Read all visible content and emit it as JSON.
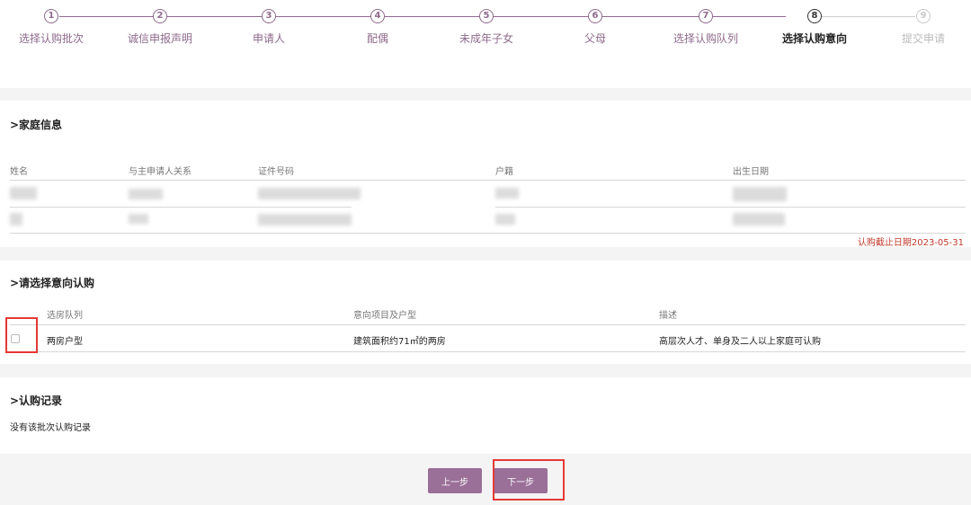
{
  "steps": [
    {
      "num": "1",
      "label": "选择认购批次"
    },
    {
      "num": "2",
      "label": "诚信申报声明"
    },
    {
      "num": "3",
      "label": "申请人"
    },
    {
      "num": "4",
      "label": "配偶"
    },
    {
      "num": "5",
      "label": "未成年子女"
    },
    {
      "num": "6",
      "label": "父母"
    },
    {
      "num": "7",
      "label": "选择认购队列"
    },
    {
      "num": "8",
      "label": "选择认购意向"
    },
    {
      "num": "9",
      "label": "提交申请"
    }
  ],
  "family": {
    "title": ">家庭信息",
    "columns": [
      "姓名",
      "与主申请人关系",
      "证件号码",
      "户籍",
      "出生日期"
    ],
    "deadline": "认购截止日期2023-05-31"
  },
  "intent": {
    "title": ">请选择意向认购",
    "columns": [
      "选房队列",
      "意向项目及户型",
      "描述"
    ],
    "row": {
      "queue": "两房户型",
      "project": "建筑面积约71㎡的两房",
      "description": "高层次人才、单身及二人以上家庭可认购"
    }
  },
  "records": {
    "title": ">认购记录",
    "empty_text": "没有该批次认购记录"
  },
  "buttons": {
    "prev": "上一步",
    "next": "下一步"
  },
  "colors": {
    "accent": "#8e6a8c",
    "button": "#9a6f98",
    "deadline": "#c0392b",
    "highlight": "#e53935"
  }
}
